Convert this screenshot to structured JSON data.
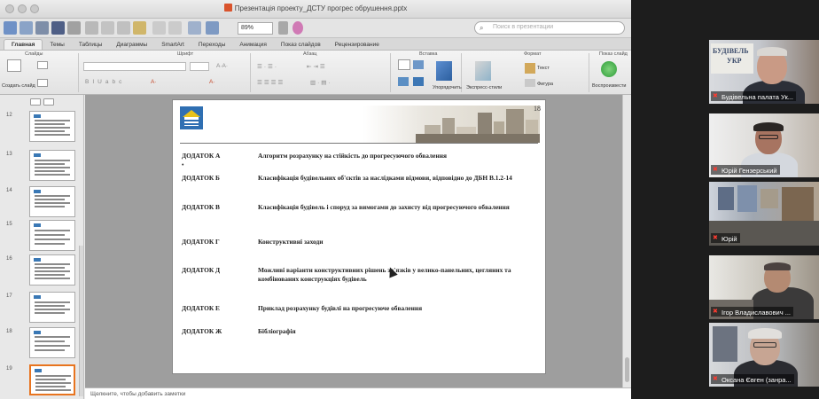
{
  "window": {
    "title": "Презентація проекту_ДСТУ прогрес обрушення.pptx",
    "zoom": "89%",
    "search_placeholder": "Поиск в презентации"
  },
  "ribbon": {
    "tabs": [
      "Главная",
      "Темы",
      "Таблицы",
      "Диаграммы",
      "SmartArt",
      "Переходы",
      "Анимация",
      "Показ слайдов",
      "Рецензирование"
    ],
    "active_tab": "Главная",
    "groups": [
      "Слайды",
      "Шрифт",
      "Абзац",
      "Вставка",
      "Формат",
      "Показ слайд"
    ],
    "buttons": {
      "new_slide": "Создать слайд",
      "arrange": "Упорядочить",
      "quick_styles": "Экспресс-стили",
      "text_box": "Текст",
      "shape": "Фигура",
      "play": "Воспроизвести"
    }
  },
  "thumbnails": {
    "numbers": [
      "12",
      "13",
      "14",
      "15",
      "16",
      "17",
      "18",
      "19"
    ],
    "selected": "19"
  },
  "slide": {
    "page_number": "18",
    "appendices": [
      {
        "key": "ДОДАТОК А",
        "text": "Алгоритм розрахунку на стійкість до прогресуючого обвалення"
      },
      {
        "key": "ДОДАТОК Б",
        "text": "Класифікація будівельних об'єктів за наслідками відмови, відповідно до ДБН В.1.2-14"
      },
      {
        "key": "ДОДАТОК В",
        "text": "Класифікація будівель і споруд за вимогами до захисту від прогресуючого обвалення"
      },
      {
        "key": "ДОДАТОК Г",
        "text": "Конструктивні заходи"
      },
      {
        "key": "ДОДАТОК Д",
        "text": "Можливі варіанти конструктивних рішень зв'язків у велико-панельних, цегляних та комбінованих конструкціях будівель"
      },
      {
        "key": "ДОДАТОК Е",
        "text": "Приклад розрахунку будівлі на прогресуюче обвалення"
      },
      {
        "key": "ДОДАТОК Ж",
        "text": " Бібліографія"
      }
    ]
  },
  "notes_placeholder": "Щелкните, чтобы добавить заметки",
  "participants": [
    {
      "name": "Будівельна палата Ук...",
      "sign_text": "БУДІВЕЛЬ",
      "sign_text2": "УКР"
    },
    {
      "name": "Юрій Гензерський"
    },
    {
      "name": "Юрій"
    },
    {
      "name": "Ігор Владиславович ..."
    },
    {
      "name": "Оксана Євген (занра..."
    }
  ],
  "colors": {
    "muted_mic": "#ff3b30",
    "selected_thumb": "#e8741f",
    "logo_blue": "#2f6fb2",
    "logo_yellow": "#e8c21a"
  }
}
